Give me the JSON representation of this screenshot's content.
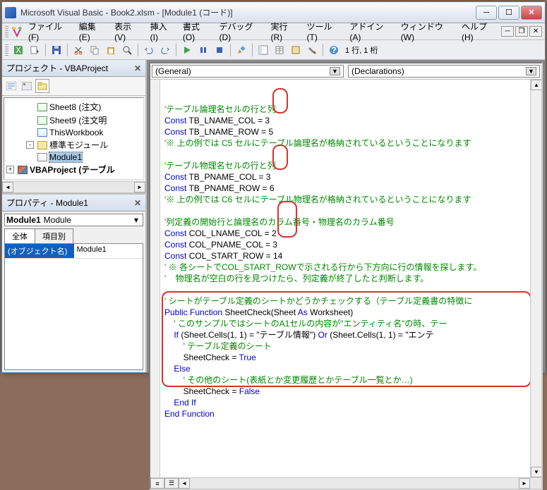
{
  "titlebar": {
    "text": "Microsoft Visual Basic - Book2.xlsm - [Module1 (コード)]"
  },
  "menus": {
    "file": "ファイル(F)",
    "edit": "編集(E)",
    "view": "表示(V)",
    "insert": "挿入(I)",
    "format": "書式(O)",
    "debug": "デバッグ(D)",
    "run": "実行(R)",
    "tools": "ツール(T)",
    "addins": "アドイン(A)",
    "window": "ウィンドウ(W)",
    "help": "ヘルプ(H)"
  },
  "toolbar": {
    "position": "1 行, 1 桁"
  },
  "project_panel": {
    "title": "プロジェクト - VBAProject",
    "items": [
      {
        "icon": "sheet",
        "label": "Sheet8 (注文)",
        "indent": 2
      },
      {
        "icon": "sheet",
        "label": "Sheet9 (注文明",
        "indent": 2
      },
      {
        "icon": "book",
        "label": "ThisWorkbook",
        "indent": 2
      },
      {
        "icon": "folder",
        "label": "標準モジュール",
        "indent": 1,
        "exp": "-"
      },
      {
        "icon": "module",
        "label": "Module1",
        "indent": 2,
        "selected": true
      },
      {
        "icon": "proj",
        "label": "VBAProject (テーブル",
        "indent": 0,
        "exp": "+",
        "bold": true
      }
    ]
  },
  "properties_panel": {
    "title": "プロパティ - Module1",
    "object_bold": "Module1",
    "object_type": "Module",
    "tabs": {
      "all": "全体",
      "cat": "項目別"
    },
    "row_key": "(オブジェクト名)",
    "row_val": "Module1"
  },
  "code_dropdowns": {
    "left": "(General)",
    "right": "(Declarations)"
  },
  "code_lines": [
    {
      "cls": "cm",
      "text": "'テーブル論理名セルの行と列"
    },
    {
      "parts": [
        {
          "cls": "kw",
          "text": "Const"
        },
        {
          "text": " TB_LNAME_COL = 3"
        }
      ]
    },
    {
      "parts": [
        {
          "cls": "kw",
          "text": "Const"
        },
        {
          "text": " TB_LNAME_ROW = 5"
        }
      ]
    },
    {
      "cls": "cm",
      "text": "'※ 上の例では C5 セルにテーブル論理名が格納されているということになります"
    },
    {
      "text": ""
    },
    {
      "cls": "cm",
      "text": "'テーブル物理名セルの行と列"
    },
    {
      "parts": [
        {
          "cls": "kw",
          "text": "Const"
        },
        {
          "text": " TB_PNAME_COL = 3"
        }
      ]
    },
    {
      "parts": [
        {
          "cls": "kw",
          "text": "Const"
        },
        {
          "text": " TB_PNAME_ROW = 6"
        }
      ]
    },
    {
      "cls": "cm",
      "text": "'※ 上の例では C6 セルにテーブル物理名が格納されているということになります"
    },
    {
      "text": ""
    },
    {
      "cls": "cm",
      "text": "'列定義の開始行と論理名のカラム番号・物理名のカラム番号"
    },
    {
      "parts": [
        {
          "cls": "kw",
          "text": "Const"
        },
        {
          "text": " COL_LNAME_COL = 2"
        }
      ]
    },
    {
      "parts": [
        {
          "cls": "kw",
          "text": "Const"
        },
        {
          "text": " COL_PNAME_COL = 3"
        }
      ]
    },
    {
      "parts": [
        {
          "cls": "kw",
          "text": "Const"
        },
        {
          "text": " COL_START_ROW = 14"
        }
      ]
    },
    {
      "cls": "cm",
      "text": "' ※ 各シートでCOL_START_ROWで示される行から下方向に行の情報を探します。"
    },
    {
      "cls": "cm",
      "text": "'    物理名が空白の行を見つけたら、列定義が終了したと判断します。"
    },
    {
      "text": ""
    },
    {
      "cls": "cm",
      "text": "' シートがテーブル定義のシートかどうかチェックする（テーブル定義書の特徴に"
    },
    {
      "parts": [
        {
          "cls": "kw",
          "text": "Public Function"
        },
        {
          "text": " SheetCheck(Sheet "
        },
        {
          "cls": "kw",
          "text": "As"
        },
        {
          "text": " Worksheet)"
        }
      ]
    },
    {
      "cls": "cm",
      "text": "    ' このサンプルではシートのA1セルの内容が\"エンティティ名\"の時、テー"
    },
    {
      "parts": [
        {
          "text": "    "
        },
        {
          "cls": "kw",
          "text": "If"
        },
        {
          "text": " (Sheet.Cells(1, 1) = \"テーブル情報\") "
        },
        {
          "cls": "kw",
          "text": "Or"
        },
        {
          "text": " (Sheet.Cells(1, 1) = \"エンテ"
        }
      ]
    },
    {
      "cls": "cm",
      "text": "        ' テーブル定義のシート"
    },
    {
      "parts": [
        {
          "text": "        SheetCheck = "
        },
        {
          "cls": "kw",
          "text": "True"
        }
      ]
    },
    {
      "parts": [
        {
          "text": "    "
        },
        {
          "cls": "kw",
          "text": "Else"
        }
      ]
    },
    {
      "cls": "cm",
      "text": "        ' その他のシート(表紙とか変更履歴とかテーブル一覧とか…)"
    },
    {
      "parts": [
        {
          "text": "        SheetCheck = "
        },
        {
          "cls": "kw",
          "text": "False"
        }
      ]
    },
    {
      "parts": [
        {
          "text": "    "
        },
        {
          "cls": "kw",
          "text": "End If"
        }
      ]
    },
    {
      "parts": [
        {
          "cls": "kw",
          "text": "End Function"
        }
      ]
    }
  ],
  "colors": {
    "keyword": "#0000c8",
    "comment": "#008800",
    "annotation": "#d83030"
  }
}
